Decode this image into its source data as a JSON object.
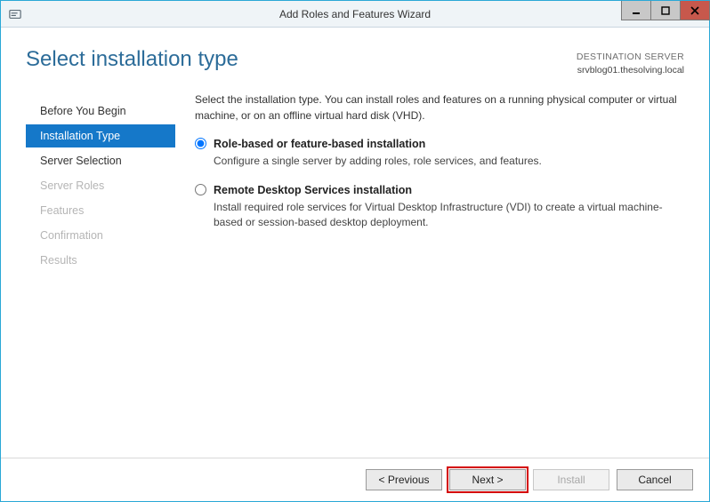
{
  "window": {
    "title": "Add Roles and Features Wizard"
  },
  "header": {
    "page_title": "Select installation type",
    "destination_label": "DESTINATION SERVER",
    "destination_server": "srvblog01.thesolving.local"
  },
  "sidebar": {
    "items": [
      {
        "label": "Before You Begin",
        "state": "normal"
      },
      {
        "label": "Installation Type",
        "state": "selected"
      },
      {
        "label": "Server Selection",
        "state": "normal"
      },
      {
        "label": "Server Roles",
        "state": "disabled"
      },
      {
        "label": "Features",
        "state": "disabled"
      },
      {
        "label": "Confirmation",
        "state": "disabled"
      },
      {
        "label": "Results",
        "state": "disabled"
      }
    ]
  },
  "content": {
    "intro": "Select the installation type. You can install roles and features on a running physical computer or virtual machine, or on an offline virtual hard disk (VHD).",
    "options": [
      {
        "title": "Role-based or feature-based installation",
        "desc": "Configure a single server by adding roles, role services, and features.",
        "checked": true
      },
      {
        "title": "Remote Desktop Services installation",
        "desc": "Install required role services for Virtual Desktop Infrastructure (VDI) to create a virtual machine-based or session-based desktop deployment.",
        "checked": false
      }
    ]
  },
  "footer": {
    "previous": "< Previous",
    "next": "Next >",
    "install": "Install",
    "cancel": "Cancel"
  }
}
